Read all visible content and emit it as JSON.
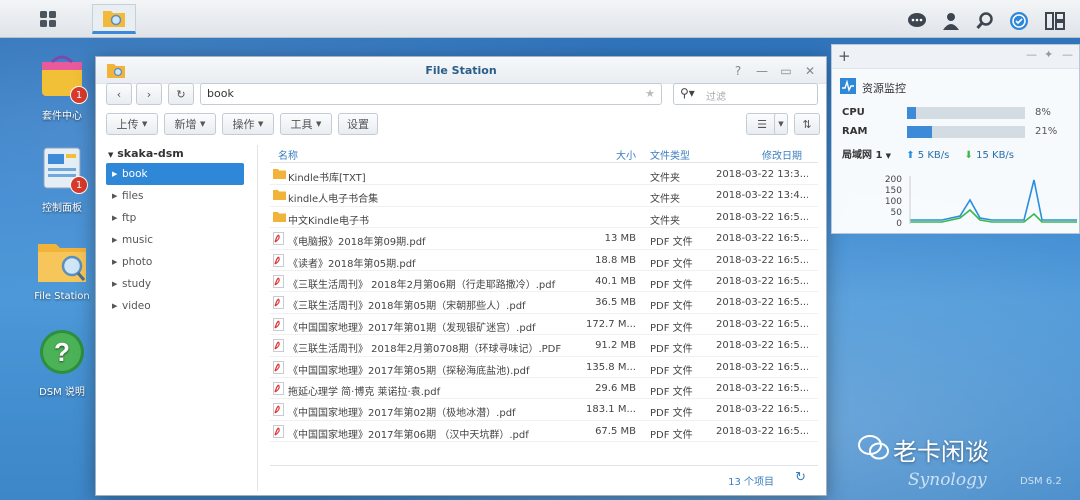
{
  "taskbar": {
    "main_menu_icon": "grid-icon",
    "open_app_icon": "file-station-icon",
    "right_icons": [
      "chat-icon",
      "user-icon",
      "search-icon",
      "clock-widget-icon",
      "widgets-icon"
    ]
  },
  "desktop": {
    "icons": [
      {
        "label": "套件中心",
        "badge": "1"
      },
      {
        "label": "控制面板",
        "badge": "1"
      },
      {
        "label": "File Station",
        "badge": ""
      },
      {
        "label": "DSM 说明",
        "badge": ""
      }
    ]
  },
  "window": {
    "title": "File Station",
    "path": "book",
    "filter_placeholder": "过滤",
    "buttons": {
      "upload": "上传",
      "create": "新增",
      "action": "操作",
      "tools": "工具",
      "settings": "设置"
    },
    "tree_root": "skaka-dsm",
    "tree": [
      "book",
      "files",
      "ftp",
      "music",
      "photo",
      "study",
      "video"
    ],
    "selected_tree": "book",
    "columns": {
      "name": "名称",
      "size": "大小",
      "type": "文件类型",
      "modified": "修改日期"
    },
    "rows": [
      {
        "name": "Kindle书库[TXT]",
        "size": "",
        "type": "文件夹",
        "date": "2018-03-22 13:3...",
        "kind": "folder"
      },
      {
        "name": "kindle人电子书合集",
        "size": "",
        "type": "文件夹",
        "date": "2018-03-22 13:4...",
        "kind": "folder"
      },
      {
        "name": "中文Kindle电子书",
        "size": "",
        "type": "文件夹",
        "date": "2018-03-22 16:5...",
        "kind": "folder"
      },
      {
        "name": "《电脑报》2018年第09期.pdf",
        "size": "13 MB",
        "type": "PDF 文件",
        "date": "2018-03-22 16:5...",
        "kind": "pdf"
      },
      {
        "name": "《读者》2018年第05期.pdf",
        "size": "18.8 MB",
        "type": "PDF 文件",
        "date": "2018-03-22 16:5...",
        "kind": "pdf"
      },
      {
        "name": "《三联生活周刊》 2018年2月第06期（行走耶路撒冷）.pdf",
        "size": "40.1 MB",
        "type": "PDF 文件",
        "date": "2018-03-22 16:5...",
        "kind": "pdf"
      },
      {
        "name": "《三联生活周刊》2018年第05期（宋朝那些人）.pdf",
        "size": "36.5 MB",
        "type": "PDF 文件",
        "date": "2018-03-22 16:5...",
        "kind": "pdf"
      },
      {
        "name": "《中国国家地理》2017年第01期（发现银矿迷宫）.pdf",
        "size": "172.7 M...",
        "type": "PDF 文件",
        "date": "2018-03-22 16:5...",
        "kind": "pdf"
      },
      {
        "name": "《三联生活周刊》 2018年2月第0708期（环球寻味记）.PDF",
        "size": "91.2 MB",
        "type": "PDF 文件",
        "date": "2018-03-22 16:5...",
        "kind": "pdf"
      },
      {
        "name": "《中国国家地理》2017年第05期（探秘海底盐池).pdf",
        "size": "135.8 M...",
        "type": "PDF 文件",
        "date": "2018-03-22 16:5...",
        "kind": "pdf"
      },
      {
        "name": "拖延心理学 简·博克 莱诺拉·袁.pdf",
        "size": "29.6 MB",
        "type": "PDF 文件",
        "date": "2018-03-22 16:5...",
        "kind": "pdf"
      },
      {
        "name": "《中国国家地理》2017年第02期（极地冰潜）.pdf",
        "size": "183.1 M...",
        "type": "PDF 文件",
        "date": "2018-03-22 16:5...",
        "kind": "pdf"
      },
      {
        "name": "《中国国家地理》2017年第06期 （汉中天坑群）.pdf",
        "size": "67.5 MB",
        "type": "PDF 文件",
        "date": "2018-03-22 16:5...",
        "kind": "pdf"
      }
    ],
    "item_count": "13 个项目"
  },
  "monitor": {
    "title": "资源监控",
    "cpu_label": "CPU",
    "cpu_value": 0.08,
    "cpu_text": "8%",
    "ram_label": "RAM",
    "ram_value": 0.21,
    "ram_text": "21%",
    "net_label": "局域网 1",
    "upload": "5 KB/s",
    "download": "15 KB/s",
    "chart_ticks": [
      "200",
      "150",
      "100",
      "50",
      "0"
    ],
    "colors": {
      "upload": "#2a8ee0",
      "download": "#3cb84a"
    }
  },
  "watermark": {
    "text": "老卡闲谈",
    "brand": "Synology",
    "version": "DSM 6.2"
  }
}
